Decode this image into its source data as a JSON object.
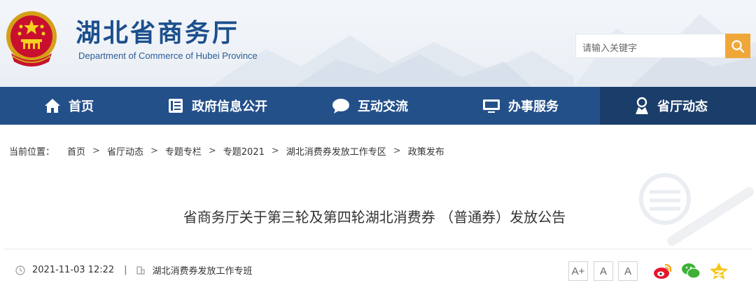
{
  "header": {
    "title": "湖北省商务厅",
    "subtitle": "Department of Commerce of Hubei Province",
    "search_placeholder": "请输入关键字"
  },
  "nav": {
    "items": [
      {
        "label": "首页",
        "icon": "home-icon"
      },
      {
        "label": "政府信息公开",
        "icon": "document-icon"
      },
      {
        "label": "互动交流",
        "icon": "chat-bubble-icon"
      },
      {
        "label": "办事服务",
        "icon": "monitor-icon"
      },
      {
        "label": "省厅动态",
        "icon": "person-icon",
        "active": true
      }
    ]
  },
  "breadcrumb": {
    "label": "当前位置：",
    "items": [
      "首页",
      "省厅动态",
      "专题专栏",
      "专题2021",
      "湖北消费券发放工作专区",
      "政策发布"
    ],
    "separator": ">"
  },
  "article": {
    "title": "省商务厅关于第三轮及第四轮湖北消费券 （普通券）发放公告",
    "date": "2021-11-03 12:22",
    "source": "湖北消费券发放工作专班"
  },
  "toolbar": {
    "font_buttons": [
      "A+",
      "A",
      "A"
    ]
  },
  "colors": {
    "nav_bg": "#24508a",
    "nav_active": "#1a3d6a",
    "brand_blue": "#1c4f8c",
    "search_btn": "#f0a73a"
  }
}
